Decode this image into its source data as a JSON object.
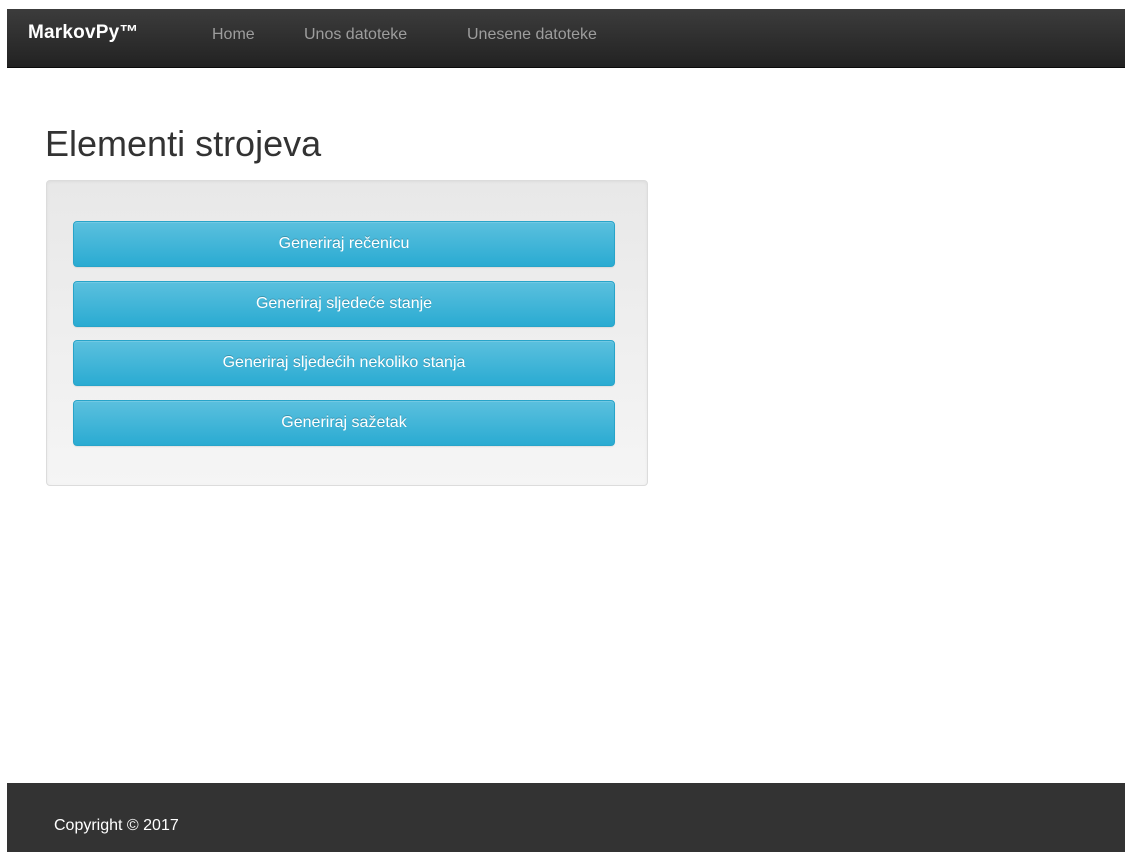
{
  "navbar": {
    "brand": "MarkovPy™",
    "links": [
      {
        "label": "Home"
      },
      {
        "label": "Unos datoteke"
      },
      {
        "label": "Unesene datoteke"
      }
    ]
  },
  "main": {
    "title": "Elementi strojeva",
    "buttons": [
      {
        "label": "Generiraj rečenicu"
      },
      {
        "label": "Generiraj sljedeće stanje"
      },
      {
        "label": "Generiraj sljedećih nekoliko stanja"
      },
      {
        "label": "Generiraj sažetak"
      }
    ]
  },
  "footer": {
    "copyright": "Copyright © 2017"
  },
  "colors": {
    "navbar_bg": "#222222",
    "nav_link": "#9d9d9d",
    "button_bg": "#5bc0de",
    "footer_bg": "#333333"
  }
}
